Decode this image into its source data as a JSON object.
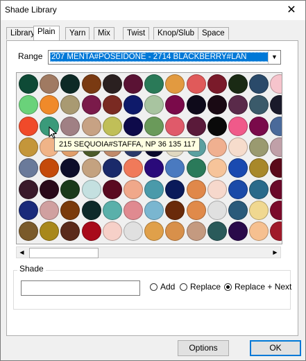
{
  "window": {
    "title": "Shade Library",
    "close_glyph": "✕"
  },
  "tabs": [
    {
      "label": "Library",
      "active": false
    },
    {
      "label": "Plain",
      "active": true
    },
    {
      "label": "Yarn",
      "active": false
    },
    {
      "label": "Mix",
      "active": false
    },
    {
      "label": "Twist",
      "active": false
    },
    {
      "label": "Knop/Slub",
      "active": false
    },
    {
      "label": "Space Dyed",
      "active": false
    }
  ],
  "range": {
    "label": "Range",
    "value": "207 MENTA#POSEIDONE - 2714 BLACKBERRY#LAN"
  },
  "swatches": [
    [
      "#0e4a36",
      "#a07a62",
      "#0d2a26",
      "#7a3a12",
      "#2a2020",
      "#5a1234",
      "#2a7a58",
      "#e29a40",
      "#e05a5a",
      "#7a1a2a",
      "#1a2a14",
      "#2a4a6a",
      "#f6c4cc"
    ],
    [
      "#6ad27a",
      "#f08a2a",
      "#a99a72",
      "#7a1a4a",
      "#7a2a22",
      "#0e1a6a",
      "#a8c4a0",
      "#7a0a4a",
      "#0e0a1a",
      "#1a0a14",
      "#5a2a4a",
      "#3a5a6a",
      "#1a1a2a"
    ],
    [
      "#f04a2a",
      "#3a9a7a",
      "#a08084",
      "#c7a284",
      "#c0bf58",
      "#0e0a4a",
      "#6a9a5a",
      "#e05a6a",
      "#5a1a3a",
      "#0a0a0a",
      "#f05a8a",
      "#7a0a4a",
      "#4a6a9a"
    ],
    [
      "#c4963a",
      "#f0b488",
      "#e09e6a",
      "#4a5a2a",
      "#c08a6a",
      "#2a3a6a",
      "#0a0a2a",
      "#e0d8c0",
      "#5aa0a0",
      "#f0b090",
      "#f6dccc",
      "#9a9a70",
      "#c0a0a8"
    ],
    [
      "#6a7a9a",
      "#c44a0a",
      "#0e0e2a",
      "#c4a280",
      "#1a2a6a",
      "#f07a5a",
      "#2a0a7a",
      "#4a7ac0",
      "#2a7a5a",
      "#f6c49a",
      "#1a4ab0",
      "#a8882a",
      "#5a0a1a"
    ],
    [
      "#3a1a2a",
      "#2a0a1a",
      "#1a3a1a",
      "#c4e0e0",
      "#5a0a20",
      "#f0a88a",
      "#4a9aaa",
      "#0a1a5a",
      "#e0884a",
      "#f6d8cc",
      "#1a4aa8",
      "#2a6a8a",
      "#6a0a2a"
    ],
    [
      "#1a2a7a",
      "#d0a0a0",
      "#7a3a0a",
      "#0e2a2a",
      "#5ab0aa",
      "#e08a90",
      "#7ab6d0",
      "#6a2a0a",
      "#e08a4a",
      "#e0e0e0",
      "#2a5a7a",
      "#f0d890",
      "#7a0a2a"
    ],
    [
      "#7a5a2a",
      "#a8881a",
      "#5a2a1a",
      "#a80a1a",
      "#f6d0c8",
      "#e0e0e0",
      "#e0a04a",
      "#d8904a",
      "#c49a80",
      "#2a5a5a",
      "#2a0a4a",
      "#f6c090",
      "#a01a2a"
    ]
  ],
  "tooltip": {
    "text": "215 SEQUOIA#STAFFA, NP 36 135 117"
  },
  "scroll": {
    "left_arrow": "◀",
    "right_arrow": "▶"
  },
  "shade": {
    "group_label": "Shade",
    "input_value": "",
    "options": [
      {
        "label": "Add",
        "selected": false
      },
      {
        "label": "Replace",
        "selected": false
      },
      {
        "label": "Replace + Next",
        "selected": true
      }
    ]
  },
  "buttons": {
    "options": "Options",
    "ok": "OK"
  }
}
